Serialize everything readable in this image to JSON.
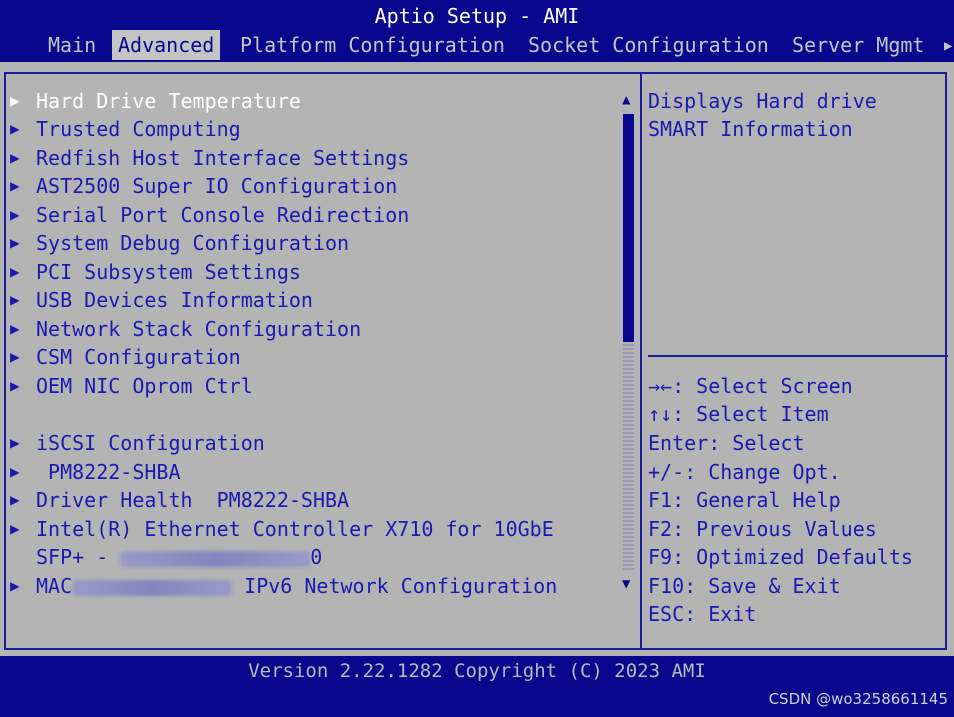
{
  "title": "Aptio Setup - AMI",
  "tabs": [
    {
      "label": "Main"
    },
    {
      "label": "Advanced"
    },
    {
      "label": "Platform Configuration"
    },
    {
      "label": "Socket Configuration"
    },
    {
      "label": "Server Mgmt"
    }
  ],
  "tabs_more_glyph": "▶",
  "menu_items": [
    {
      "label": "Hard Drive Temperature"
    },
    {
      "label": "Trusted Computing"
    },
    {
      "label": "Redfish Host Interface Settings"
    },
    {
      "label": "AST2500 Super IO Configuration"
    },
    {
      "label": "Serial Port Console Redirection"
    },
    {
      "label": "System Debug Configuration"
    },
    {
      "label": "PCI Subsystem Settings"
    },
    {
      "label": "USB Devices Information"
    },
    {
      "label": "Network Stack Configuration"
    },
    {
      "label": "CSM Configuration"
    },
    {
      "label": "OEM NIC Oprom Ctrl"
    },
    {
      "label": "iSCSI Configuration"
    },
    {
      "label": " PM8222-SHBA"
    },
    {
      "label": "Driver Health  PM8222-SHBA"
    },
    {
      "label": "Intel(R) Ethernet Controller X710 for 10GbE"
    },
    {
      "label_prefix": "SFP+ - ",
      "label_suffix": "0"
    },
    {
      "label_prefix": "MAC",
      "label_suffix": " IPv6 Network Configuration"
    }
  ],
  "arrow_glyph": "▶",
  "help_text": [
    "Displays Hard drive",
    "SMART Information"
  ],
  "key_help": [
    {
      "key": "→←",
      "text": ": Select Screen"
    },
    {
      "key": "↑↓",
      "text": ": Select Item"
    },
    {
      "key": "Enter",
      "text": ": Select"
    },
    {
      "key": "+/-",
      "text": ": Change Opt."
    },
    {
      "key": "F1",
      "text": ": General Help"
    },
    {
      "key": "F2",
      "text": ": Previous Values"
    },
    {
      "key": "F9",
      "text": ": Optimized Defaults"
    },
    {
      "key": "F10",
      "text": ": Save & Exit"
    },
    {
      "key": "ESC",
      "text": ": Exit"
    }
  ],
  "scroll_up_glyph": "▲",
  "scroll_down_glyph": "▼",
  "footer": "Version 2.22.1282 Copyright (C) 2023 AMI",
  "watermark": "CSDN @wo3258661145",
  "colors": {
    "background_blue": "#08088f",
    "panel_gray": "#b4b4b4",
    "item_text": "#1a1ab0",
    "selected_text": "#ffffff",
    "header_text": "#c4c4c4"
  }
}
